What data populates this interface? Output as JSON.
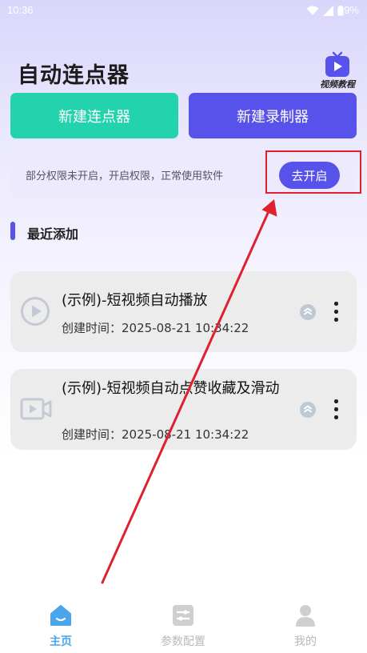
{
  "status_bar": {
    "time": "10:36",
    "battery": "89%"
  },
  "header": {
    "title": "自动连点器",
    "tutorial_label": "视频教程"
  },
  "actions": {
    "new_clicker": "新建连点器",
    "new_recorder": "新建录制器"
  },
  "permission": {
    "message": "部分权限未开启，开启权限，正常使用软件",
    "button": "去开启"
  },
  "recent": {
    "title": "最近添加",
    "items": [
      {
        "title": "(示例)-短视频自动播放",
        "created": "创建时间：2025-08-21 10:34:22",
        "icon": "play-circle-icon"
      },
      {
        "title": "(示例)-短视频自动点赞收藏及滑动",
        "created": "创建时间：2025-08-21 10:34:22",
        "icon": "video-camera-icon"
      }
    ]
  },
  "nav": {
    "items": [
      {
        "label": "主页",
        "icon": "home-icon",
        "active": true
      },
      {
        "label": "参数配置",
        "icon": "sliders-icon",
        "active": false
      },
      {
        "label": "我的",
        "icon": "user-icon",
        "active": false
      }
    ]
  },
  "colors": {
    "primary": "#5752e9",
    "teal": "#23d3ad",
    "annotation": "#e0202f",
    "nav_active": "#4aa6ec"
  }
}
